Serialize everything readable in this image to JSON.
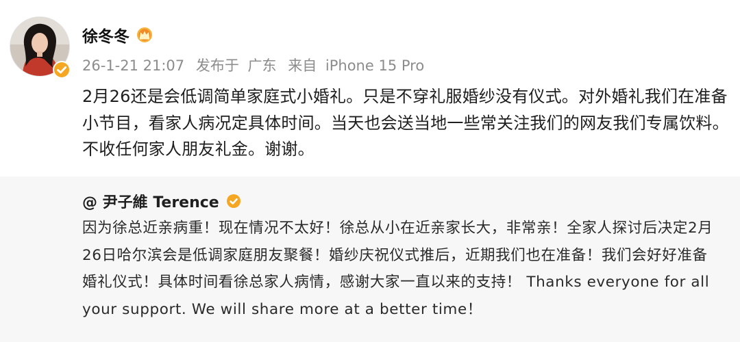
{
  "post": {
    "username": "徐冬冬",
    "meta": {
      "datetime": "26-1-21 21:07",
      "published_label": "发布于",
      "location": "广东",
      "source_label": "来自",
      "device": "iPhone 15 Pro"
    },
    "content": "2月26还是会低调简单家庭式小婚礼。只是不穿礼服婚纱没有仪式。对外婚礼我们在准备小节目，看家人病况定具体时间。当天也会送当地一些常关注我们的网友我们专属饮料。不收任何家人朋友礼金。谢谢。"
  },
  "repost": {
    "author": "@ 尹子維 Terence",
    "text": "因为徐总近亲病重！现在情况不太好！徐总从小在近亲家长大，非常亲！全家人探讨后决定2月26日哈尔滨会是低调家庭朋友聚餐！婚纱庆祝仪式推后，近期我们也在准备！我们会好好准备婚礼仪式！具体时间看徐总家人病情，感谢大家一直以来的支持！ Thanks everyone for all your support.  We will share more at a better time！"
  },
  "colors": {
    "verified_badge": "#f5a623",
    "meta_text": "#8c8c8c",
    "repost_bg": "#f7f7f7"
  },
  "icons": {
    "verified": "verified-badge-icon",
    "crown": "crown-level-icon",
    "repost_verified": "verified-badge-icon"
  }
}
